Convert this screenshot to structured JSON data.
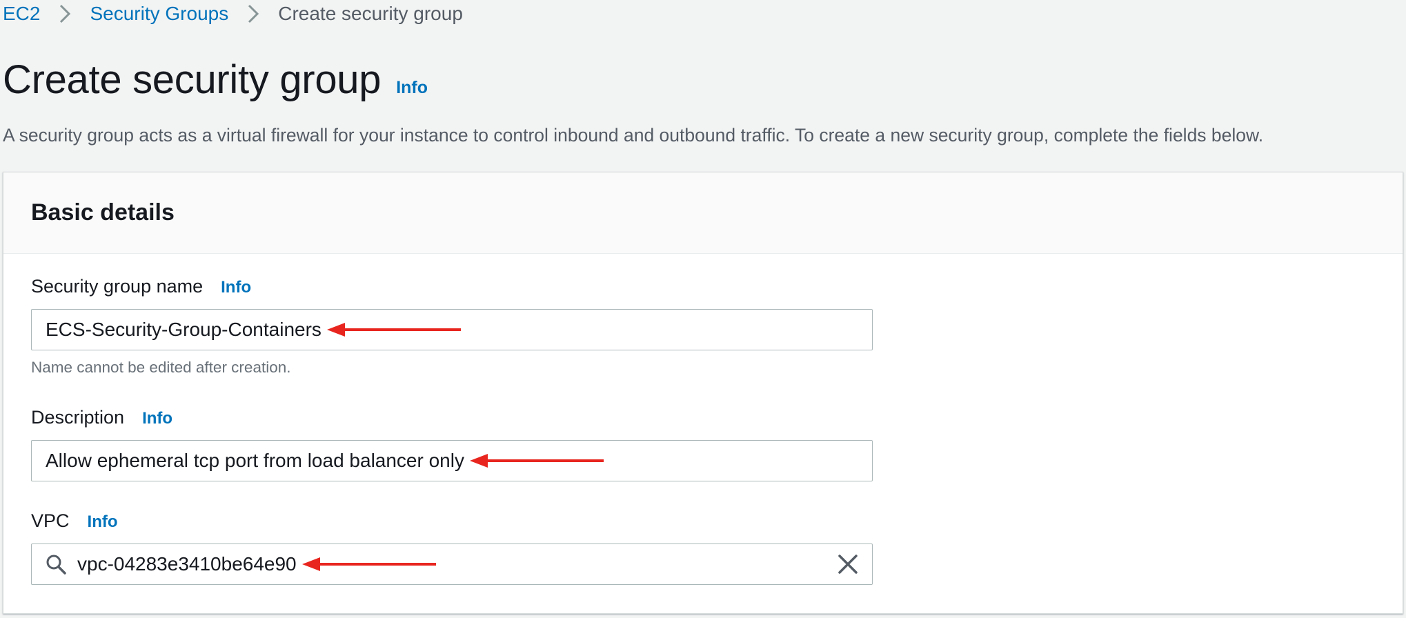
{
  "breadcrumb": {
    "items": [
      "EC2",
      "Security Groups"
    ],
    "current": "Create security group"
  },
  "header": {
    "title": "Create security group",
    "info_label": "Info",
    "description": "A security group acts as a virtual firewall for your instance to control inbound and outbound traffic. To create a new security group, complete the fields below."
  },
  "basic_details": {
    "title": "Basic details",
    "name_field": {
      "label": "Security group name",
      "info_label": "Info",
      "value": "ECS-Security-Group-Containers",
      "constraint": "Name cannot be edited after creation."
    },
    "description_field": {
      "label": "Description",
      "info_label": "Info",
      "value": "Allow ephemeral tcp port from load balancer only"
    },
    "vpc_field": {
      "label": "VPC",
      "info_label": "Info",
      "value": "vpc-04283e3410be64e90",
      "search_icon": "search-icon",
      "clear_icon": "close-icon"
    }
  },
  "colors": {
    "link": "#0073bb",
    "annotation_arrow": "#e8261f",
    "page_bg": "#f2f3f3",
    "input_border": "#aab7b8"
  }
}
